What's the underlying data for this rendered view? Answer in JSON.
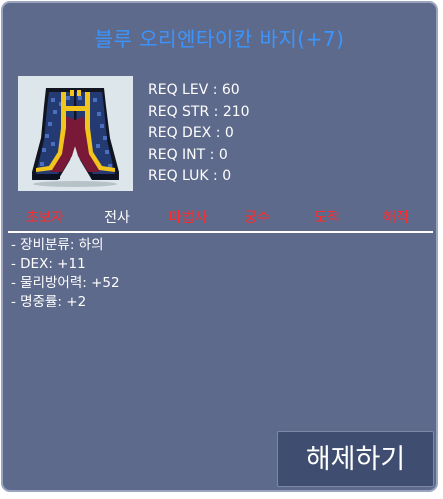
{
  "item": {
    "title": "블루 오리엔타이칸 바지(+7)",
    "icon": "blue-pants-icon"
  },
  "requirements": [
    "REQ LEV : 60",
    "REQ STR : 210",
    "REQ DEX : 0",
    "REQ INT : 0",
    "REQ LUK : 0"
  ],
  "jobs": [
    {
      "label": "초보자",
      "color": "#ff2a2a"
    },
    {
      "label": "전사",
      "color": "#ffffff"
    },
    {
      "label": "마법사",
      "color": "#ff2a2a"
    },
    {
      "label": "궁수",
      "color": "#ff2a2a"
    },
    {
      "label": "도적",
      "color": "#ff2a2a"
    },
    {
      "label": "해적",
      "color": "#ff2a2a"
    }
  ],
  "stats": [
    "- 장비분류: 하의",
    "- DEX: +11",
    "- 물리방어력: +52",
    "- 명중률: +2"
  ],
  "actions": {
    "unequip_label": "해제하기"
  },
  "colors": {
    "panel_bg": "#5e6a8b",
    "title": "#3b95ff",
    "job_unavailable": "#ff2a2a",
    "job_available": "#ffffff",
    "button_bg": "#3f4d70"
  }
}
